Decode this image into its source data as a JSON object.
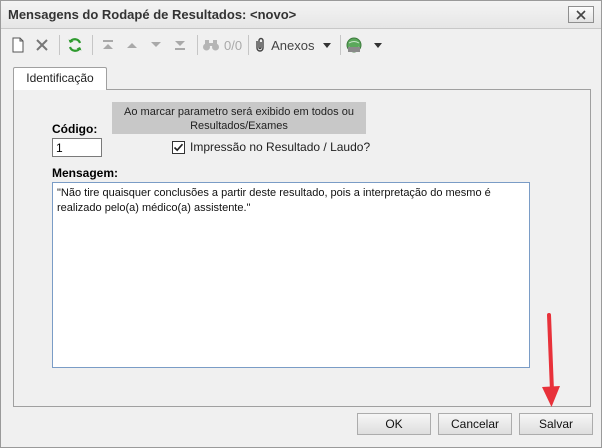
{
  "window": {
    "title": "Mensagens do Rodapé de Resultados: <novo>"
  },
  "toolbar": {
    "record_counter": "0/0",
    "anexos_label": "Anexos"
  },
  "tabs": [
    {
      "label": "Identificação",
      "active": true
    }
  ],
  "form": {
    "hint_text": "Ao marcar parametro será exibido em todos ou Resultados/Exames",
    "codigo_label": "Código:",
    "codigo_value": "1",
    "impressao_label": "Impressão no Resultado / Laudo?",
    "impressao_checked": true,
    "mensagem_label": "Mensagem:",
    "mensagem_value": "\"Não tire quaisquer conclusões a partir deste resultado, pois a interpretação do mesmo é realizado pelo(a) médico(a) assistente.\""
  },
  "footer": {
    "ok_label": "OK",
    "cancel_label": "Cancelar",
    "save_label": "Salvar"
  },
  "colors": {
    "annotation_arrow": "#e8313a",
    "refresh_icon": "#2e9a2e"
  }
}
